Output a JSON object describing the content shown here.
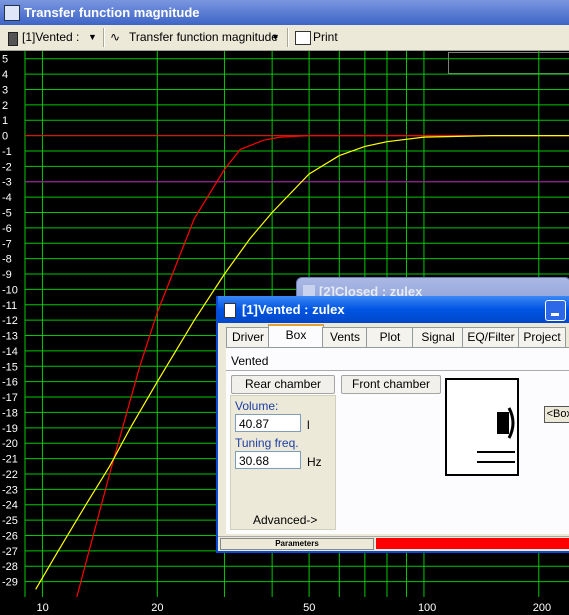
{
  "window": {
    "title": "Transfer function magnitude"
  },
  "toolbar": {
    "box_select": "[1]Vented :",
    "tf_select": "Transfer function magnitude",
    "print_label": "Print"
  },
  "plot": {
    "bg_color": "#000000",
    "grid_color": "#00c800",
    "y_ticks": [
      "5",
      "4",
      "3",
      "2",
      "1",
      "0",
      "-1",
      "-2",
      "-3",
      "-4",
      "-5",
      "-6",
      "-7",
      "-8",
      "-9",
      "-10",
      "-11",
      "-12",
      "-13",
      "-14",
      "-15",
      "-16",
      "-17",
      "-18",
      "-19",
      "-20",
      "-21",
      "-22",
      "-23",
      "-24",
      "-25",
      "-26",
      "-27",
      "-28",
      "-29"
    ],
    "x_ticks": [
      "10",
      "20",
      "50",
      "100",
      "200"
    ],
    "ref_line_color": "#ff0000",
    "minus3_line_color": "#c000c0"
  },
  "chart_data": {
    "type": "line",
    "xscale": "log",
    "xlim": [
      9,
      240
    ],
    "ylim": [
      -30,
      5.5
    ],
    "hlines": [
      {
        "y": 0,
        "color": "#ff0000"
      },
      {
        "y": -3,
        "color": "#c000c0"
      }
    ],
    "series": [
      {
        "color": "#ff0000",
        "x": [
          12.3,
          15,
          18,
          20,
          25,
          30,
          33,
          38,
          42,
          50,
          70,
          100,
          150,
          240
        ],
        "y": [
          -30,
          -22,
          -15,
          -11.5,
          -5.4,
          -2.2,
          -0.9,
          -0.3,
          -0.1,
          0,
          0,
          0,
          0,
          0
        ]
      },
      {
        "color": "#ffff00",
        "x": [
          9.6,
          11,
          13,
          15,
          17,
          20,
          25,
          30,
          35,
          40,
          50,
          60,
          70,
          80,
          100,
          150,
          240
        ],
        "y": [
          -29.5,
          -27,
          -24,
          -21.5,
          -19,
          -16,
          -12,
          -9,
          -6.7,
          -5,
          -2.5,
          -1.3,
          -0.7,
          -0.4,
          -0.1,
          0,
          0
        ]
      }
    ]
  },
  "bg_window": {
    "title": "[2]Closed : zulex"
  },
  "dialog": {
    "title": "[1]Vented : zulex",
    "tabs": [
      "Driver",
      "Box",
      "Vents",
      "Plot",
      "Signal",
      "EQ/Filter",
      "Project"
    ],
    "active_tab": "Box",
    "type_value": "Vented",
    "rear_label": "Rear chamber",
    "front_label": "Front chamber",
    "volume_label": "Volume:",
    "volume_value": "40.87",
    "volume_unit": "l",
    "tuning_label": "Tuning freq.",
    "tuning_value": "30.68",
    "tuning_unit": "Hz",
    "advanced_label": "Advanced->",
    "box_button": "<Box>",
    "status_label": "Parameters",
    "status_color": "#ff0000"
  }
}
